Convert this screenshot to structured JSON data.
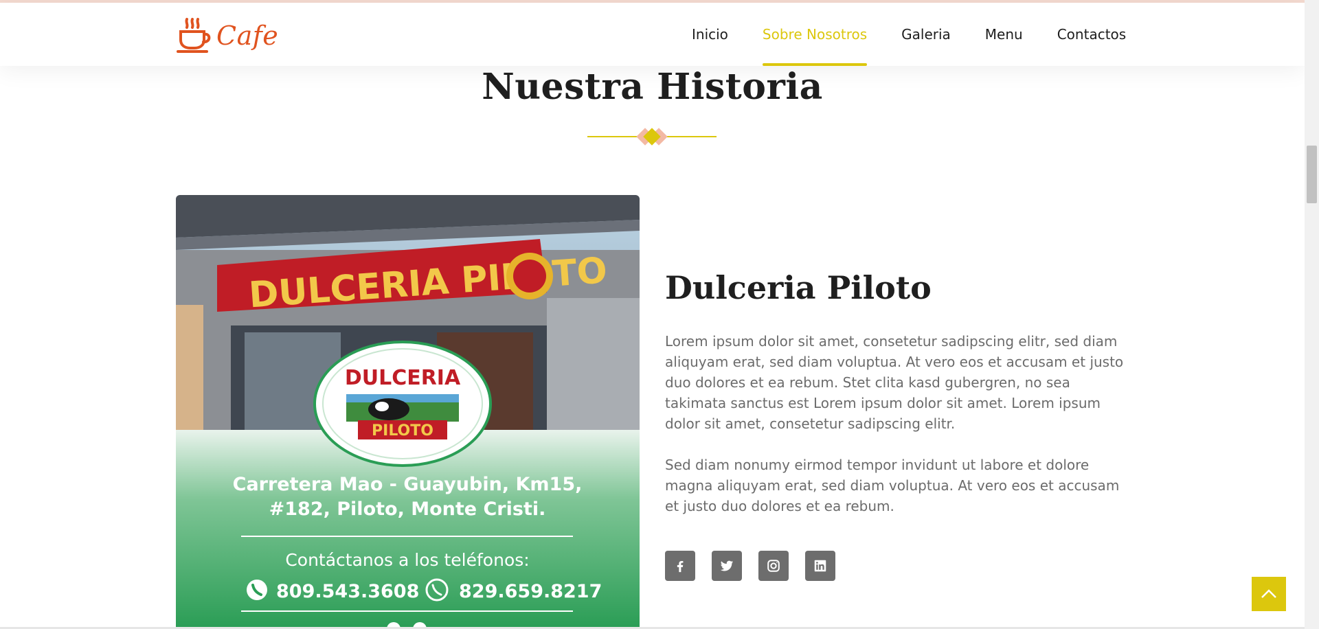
{
  "brand": {
    "name": "Cafe",
    "icon": "coffee-cup-icon",
    "color": "#e0531f"
  },
  "nav": {
    "items": [
      {
        "label": "Inicio",
        "active": false
      },
      {
        "label": "Sobre Nosotros",
        "active": true
      },
      {
        "label": "Galeria",
        "active": false
      },
      {
        "label": "Menu",
        "active": false
      },
      {
        "label": "Contactos",
        "active": false
      }
    ],
    "active_color": "#dcc70d"
  },
  "section": {
    "title": "Nuestra Historia"
  },
  "photo": {
    "sign_text": "DULCERIA PILOTO",
    "badge_top": "DULCERIA",
    "badge_bottom": "PILOTO",
    "address_line1": "Carretera Mao - Guayubin, Km15,",
    "address_line2": "#182, Piloto, Monte Cristi.",
    "contact_label": "Contáctanos a los teléfonos:",
    "phone1": "809.543.3608",
    "phone2": "829.659.8217"
  },
  "story": {
    "title": "Dulceria Piloto",
    "paragraph1": "Lorem ipsum dolor sit amet, consetetur sadipscing elitr, sed diam aliquyam erat, sed diam voluptua. At vero eos et accusam et justo duo dolores et ea rebum. Stet clita kasd gubergren, no sea takimata sanctus est Lorem ipsum dolor sit amet. Lorem ipsum dolor sit amet, consetetur sadipscing elitr.",
    "paragraph2": "Sed diam nonumy eirmod tempor invidunt ut labore et dolore magna aliquyam erat, sed diam voluptua. At vero eos et accusam et justo duo dolores et ea rebum."
  },
  "social": [
    {
      "icon": "facebook-icon"
    },
    {
      "icon": "twitter-icon"
    },
    {
      "icon": "instagram-icon"
    },
    {
      "icon": "linkedin-icon"
    }
  ],
  "back_to_top": {
    "icon": "chevron-up-icon",
    "color": "#dcc70d"
  }
}
